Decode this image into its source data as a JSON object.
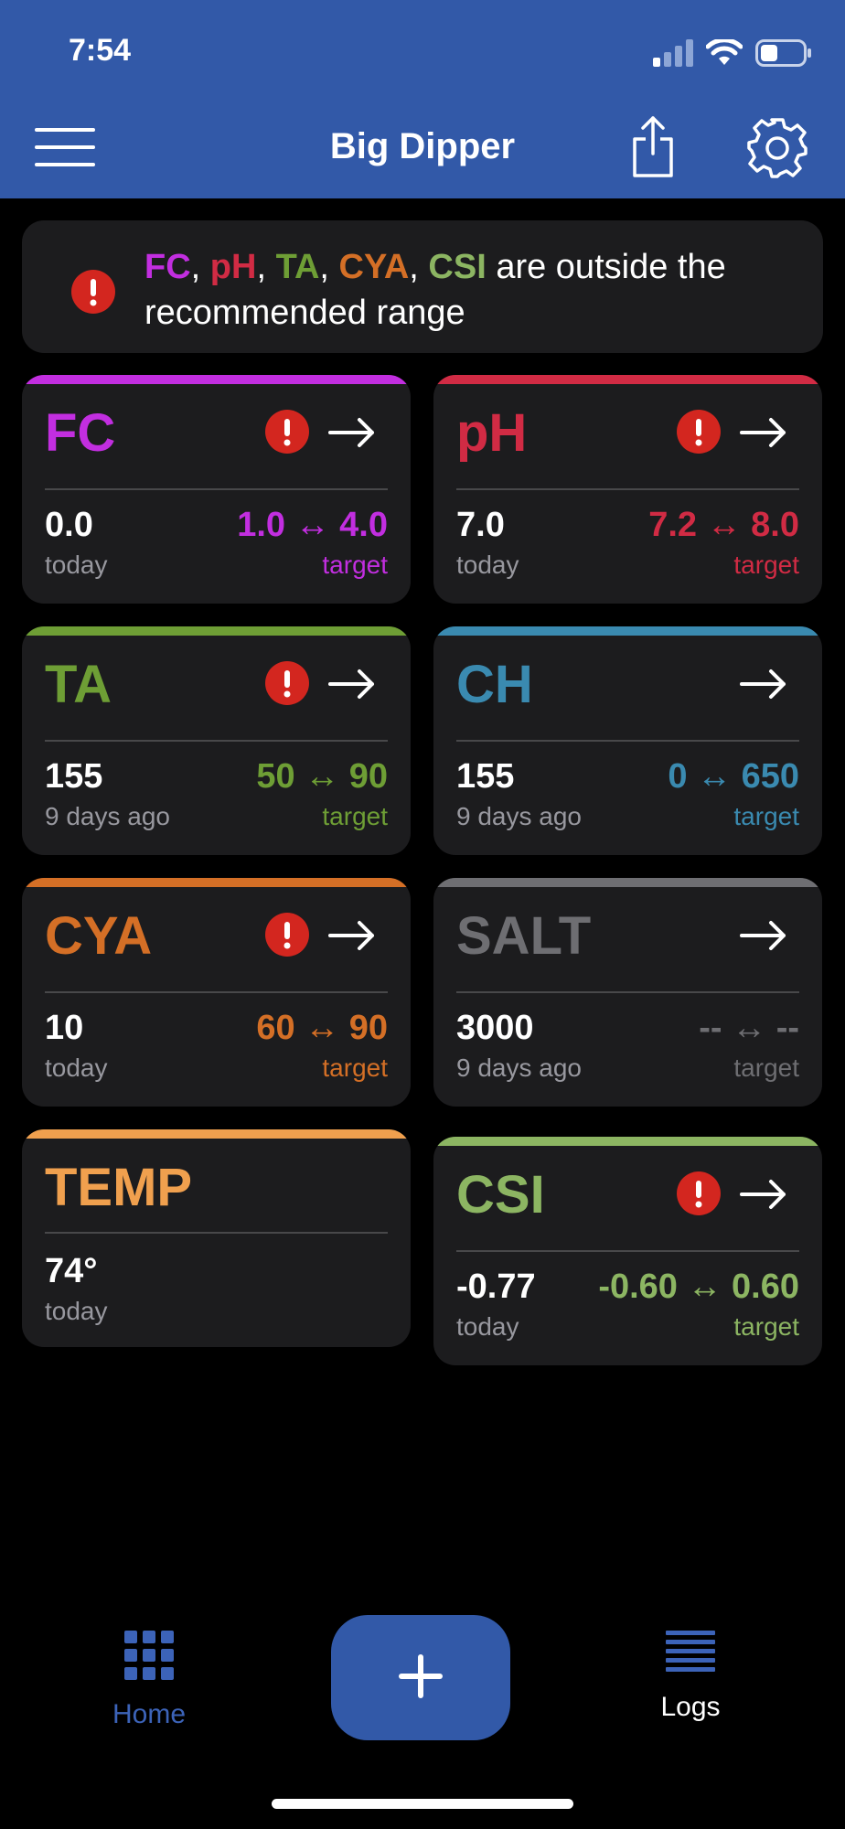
{
  "status": {
    "time": "7:54"
  },
  "header": {
    "title": "Big Dipper"
  },
  "alert": {
    "items": [
      {
        "label": "FC",
        "color": "#c22ee0"
      },
      {
        "label": "pH",
        "color": "#d12b44"
      },
      {
        "label": "TA",
        "color": "#6e9e35"
      },
      {
        "label": "CYA",
        "color": "#d46f26"
      },
      {
        "label": "CSI",
        "color": "#8cb562"
      }
    ],
    "sep": ", ",
    "message": " are outside the recommended range"
  },
  "cards": [
    {
      "name": "FC",
      "color": "#c22ee0",
      "warn": true,
      "arrow": true,
      "value": "0.0",
      "when": "today",
      "range": "1.0 ↔ 4.0",
      "target": "target"
    },
    {
      "name": "pH",
      "color": "#d12b44",
      "warn": true,
      "arrow": true,
      "value": "7.0",
      "when": "today",
      "range": "7.2 ↔ 8.0",
      "target": "target"
    },
    {
      "name": "TA",
      "color": "#6e9e35",
      "warn": true,
      "arrow": true,
      "value": "155",
      "when": "9 days ago",
      "range": "50 ↔ 90",
      "target": "target"
    },
    {
      "name": "CH",
      "color": "#3a8ab0",
      "warn": false,
      "arrow": true,
      "value": "155",
      "when": "9 days ago",
      "range": "0 ↔ 650",
      "target": "target"
    },
    {
      "name": "CYA",
      "color": "#d46f26",
      "warn": true,
      "arrow": true,
      "value": "10",
      "when": "today",
      "range": "60 ↔ 90",
      "target": "target"
    },
    {
      "name": "SALT",
      "color": "#6e6e72",
      "warn": false,
      "arrow": true,
      "value": "3000",
      "when": "9 days ago",
      "range": "-- ↔ --",
      "target": "target"
    },
    {
      "name": "TEMP",
      "color": "#f0a04e",
      "warn": false,
      "arrow": false,
      "value": "74°",
      "when": "today",
      "range": "",
      "target": ""
    },
    {
      "name": "CSI",
      "color": "#8cb562",
      "warn": true,
      "arrow": true,
      "value": "-0.77",
      "when": "today",
      "range": "-0.60 ↔ 0.60",
      "target": "target"
    }
  ],
  "tabs": {
    "home": "Home",
    "logs": "Logs"
  },
  "colors": {
    "accent": "#3259a8",
    "warning": "#d3261f",
    "tab_active": "#3c63b8"
  }
}
